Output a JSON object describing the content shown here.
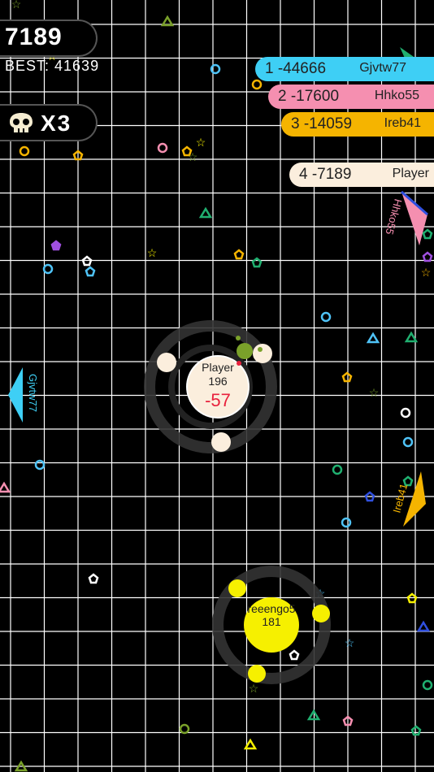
{
  "hud": {
    "score": "7189",
    "best": "BEST: 41639",
    "kills": "X3"
  },
  "leaderboard": [
    {
      "rank_score": "1 -44666",
      "name": "Gjvtw77",
      "color": "#3ecff5"
    },
    {
      "rank_score": "2 -17600",
      "name": "Hhko55",
      "color": "#f58fb0"
    },
    {
      "rank_score": "3 -14059",
      "name": "Ireb41",
      "color": "#f5b400"
    },
    {
      "rank_score": "4 -7189",
      "name": "Player",
      "color": "#fbeedd"
    }
  ],
  "player": {
    "name": "Player",
    "mass": "196",
    "delta": "-57",
    "color": "#fbeedd"
  },
  "enemy": {
    "name": "reeengo5",
    "mass": "181",
    "color": "#f6f000"
  },
  "pointer_labels": {
    "left": "Gjvtw77",
    "right_top": "Hhko55",
    "right_mid": "Ireb41"
  },
  "colors": {
    "grid": "#ffffff",
    "delta": "#e8203c"
  }
}
